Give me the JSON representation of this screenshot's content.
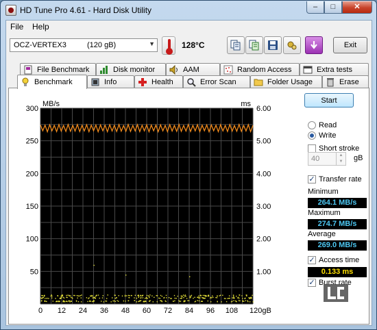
{
  "window": {
    "title": "HD Tune Pro 4.61 - Hard Disk Utility",
    "minimize": "–",
    "maximize": "□",
    "close": "✕"
  },
  "menu": [
    "File",
    "Help"
  ],
  "toolbar": {
    "drive_name": "OCZ-VERTEX3",
    "drive_size": "(120 gB)",
    "temperature": "128°C",
    "exit": "Exit",
    "icons": [
      "copy-icon",
      "copy-all-icon",
      "save-icon",
      "options-icon",
      "download-icon"
    ]
  },
  "tabs_top": [
    {
      "label": "File Benchmark",
      "icon": "file-benchmark-icon"
    },
    {
      "label": "Disk monitor",
      "icon": "disk-monitor-icon"
    },
    {
      "label": "AAM",
      "icon": "speaker-icon"
    },
    {
      "label": "Random Access",
      "icon": "random-access-icon"
    },
    {
      "label": "Extra tests",
      "icon": "extra-tests-icon"
    }
  ],
  "tabs_bottom": [
    {
      "label": "Benchmark",
      "icon": "benchmark-icon",
      "active": true
    },
    {
      "label": "Info",
      "icon": "info-icon"
    },
    {
      "label": "Health",
      "icon": "health-icon"
    },
    {
      "label": "Error Scan",
      "icon": "error-scan-icon"
    },
    {
      "label": "Folder Usage",
      "icon": "folder-icon"
    },
    {
      "label": "Erase",
      "icon": "trash-icon"
    }
  ],
  "side": {
    "start": "Start",
    "read": "Read",
    "write": "Write",
    "mode_selected": "Write",
    "short_stroke": "Short stroke",
    "short_stroke_checked": false,
    "short_stroke_value": "40",
    "short_stroke_unit": "gB",
    "transfer_rate": "Transfer rate",
    "transfer_rate_checked": true,
    "minimum_label": "Minimum",
    "minimum": "264.1 MB/s",
    "maximum_label": "Maximum",
    "maximum": "274.7 MB/s",
    "average_label": "Average",
    "average": "269.0 MB/s",
    "access_time": "Access time",
    "access_time_checked": true,
    "access_time_value": "0.133 ms",
    "burst_rate": "Burst rate",
    "burst_rate_checked": true
  },
  "chart_data": {
    "type": "line",
    "left_unit": "MB/s",
    "right_unit": "ms",
    "ylim": [
      0,
      300
    ],
    "y2lim": [
      0,
      6.0
    ],
    "xlim": [
      0,
      120
    ],
    "y_ticks": [
      "300",
      "250",
      "200",
      "150",
      "100",
      "50"
    ],
    "y2_ticks": [
      "6.00",
      "5.00",
      "4.00",
      "3.00",
      "2.00",
      "1.00"
    ],
    "x_ticks": [
      "0",
      "12",
      "24",
      "36",
      "48",
      "60",
      "72",
      "84",
      "96",
      "108",
      "120gB"
    ],
    "grid": true,
    "colors": {
      "background": "#000000",
      "grid": "#4a4a4a",
      "transfer": "#f08a1c",
      "access": "#e7e23a"
    },
    "series": [
      {
        "name": "Transfer rate",
        "axis": "left",
        "min": 264.1,
        "max": 274.7,
        "average": 269.0,
        "oscillation_periods": 46
      },
      {
        "name": "Access time",
        "axis": "right",
        "average": 0.133
      }
    ]
  }
}
